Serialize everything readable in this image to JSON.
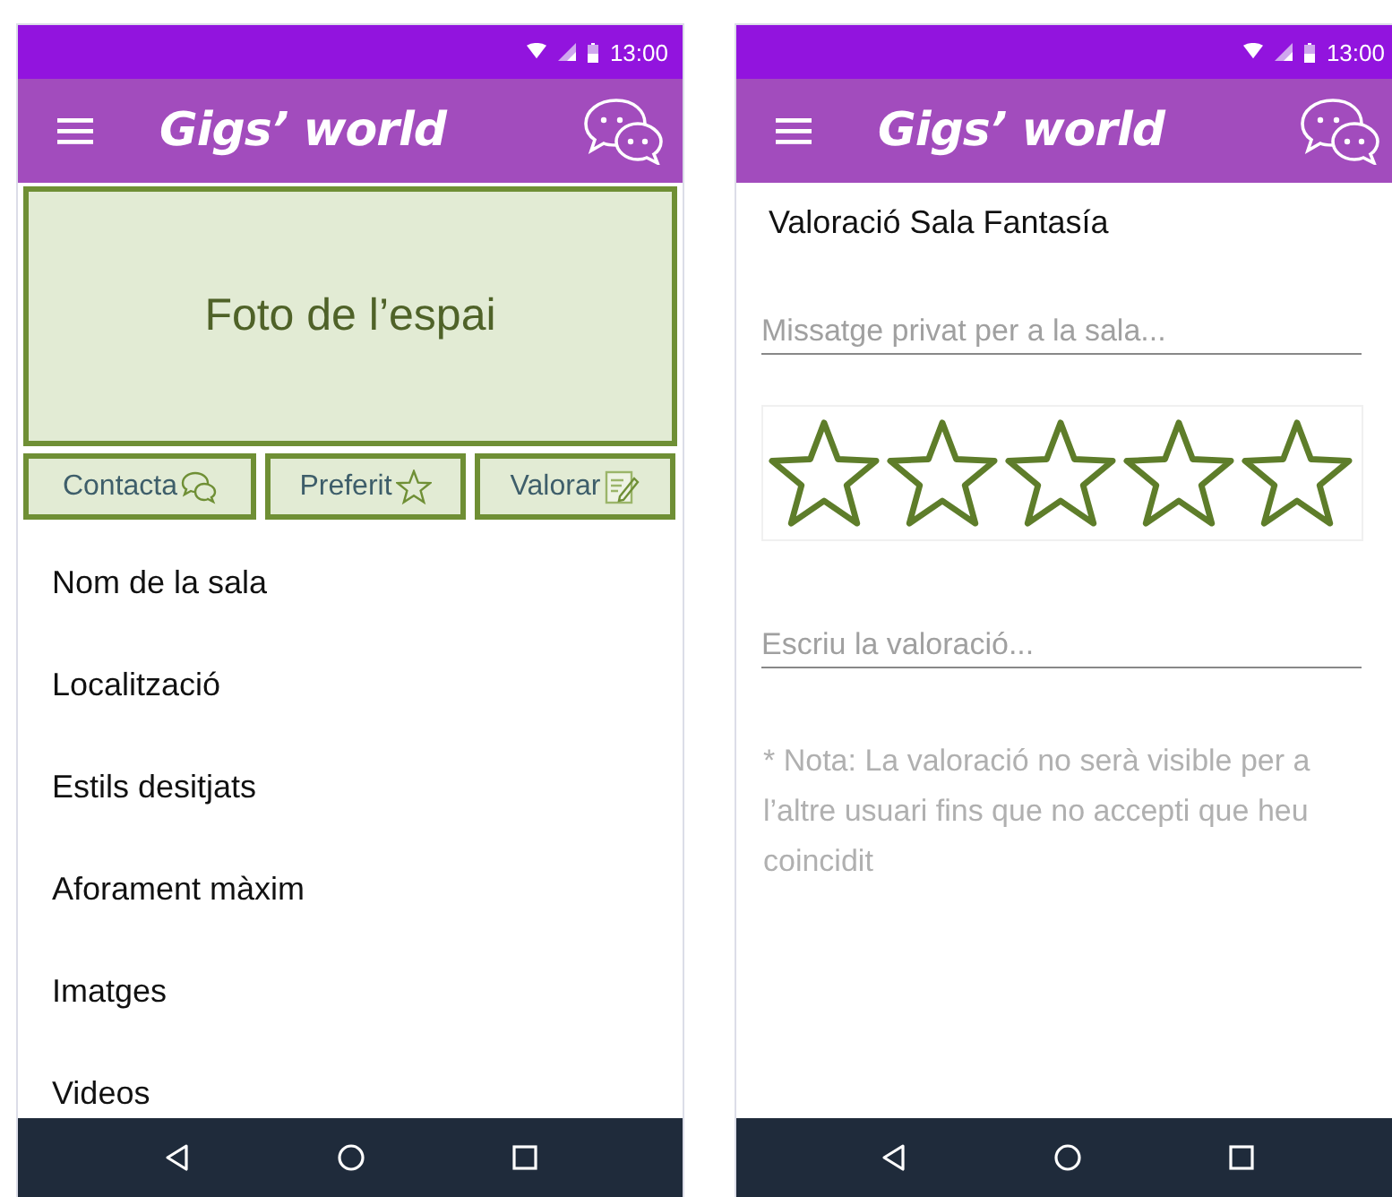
{
  "profile_screen": {
    "status_bar": {
      "time": "13:00"
    },
    "app_bar": {
      "title": "Gigs’ world"
    },
    "photo_placeholder": "Foto de l’espai",
    "action_buttons": [
      {
        "label": "Contacta",
        "kind": "contact"
      },
      {
        "label": "Preferit",
        "kind": "favorite"
      },
      {
        "label": "Valorar",
        "kind": "rate"
      }
    ],
    "details": [
      "Nom de la sala",
      "Localització",
      "Estils desitjats",
      "Aforament màxim",
      "Imatges",
      "Videos"
    ]
  },
  "rating_screen": {
    "status_bar": {
      "time": "13:00"
    },
    "app_bar": {
      "title": "Gigs’ world"
    },
    "heading": "Valoració Sala Fantasía",
    "message_field": {
      "placeholder": "Missatge privat per a la sala..."
    },
    "rating": {
      "stars": 0
    },
    "review_field": {
      "placeholder": "Escriu la valoració..."
    },
    "note": "* Nota: La valoració no serà visible per a l’altre usuari fins que no accepti que heu coincidit"
  }
}
